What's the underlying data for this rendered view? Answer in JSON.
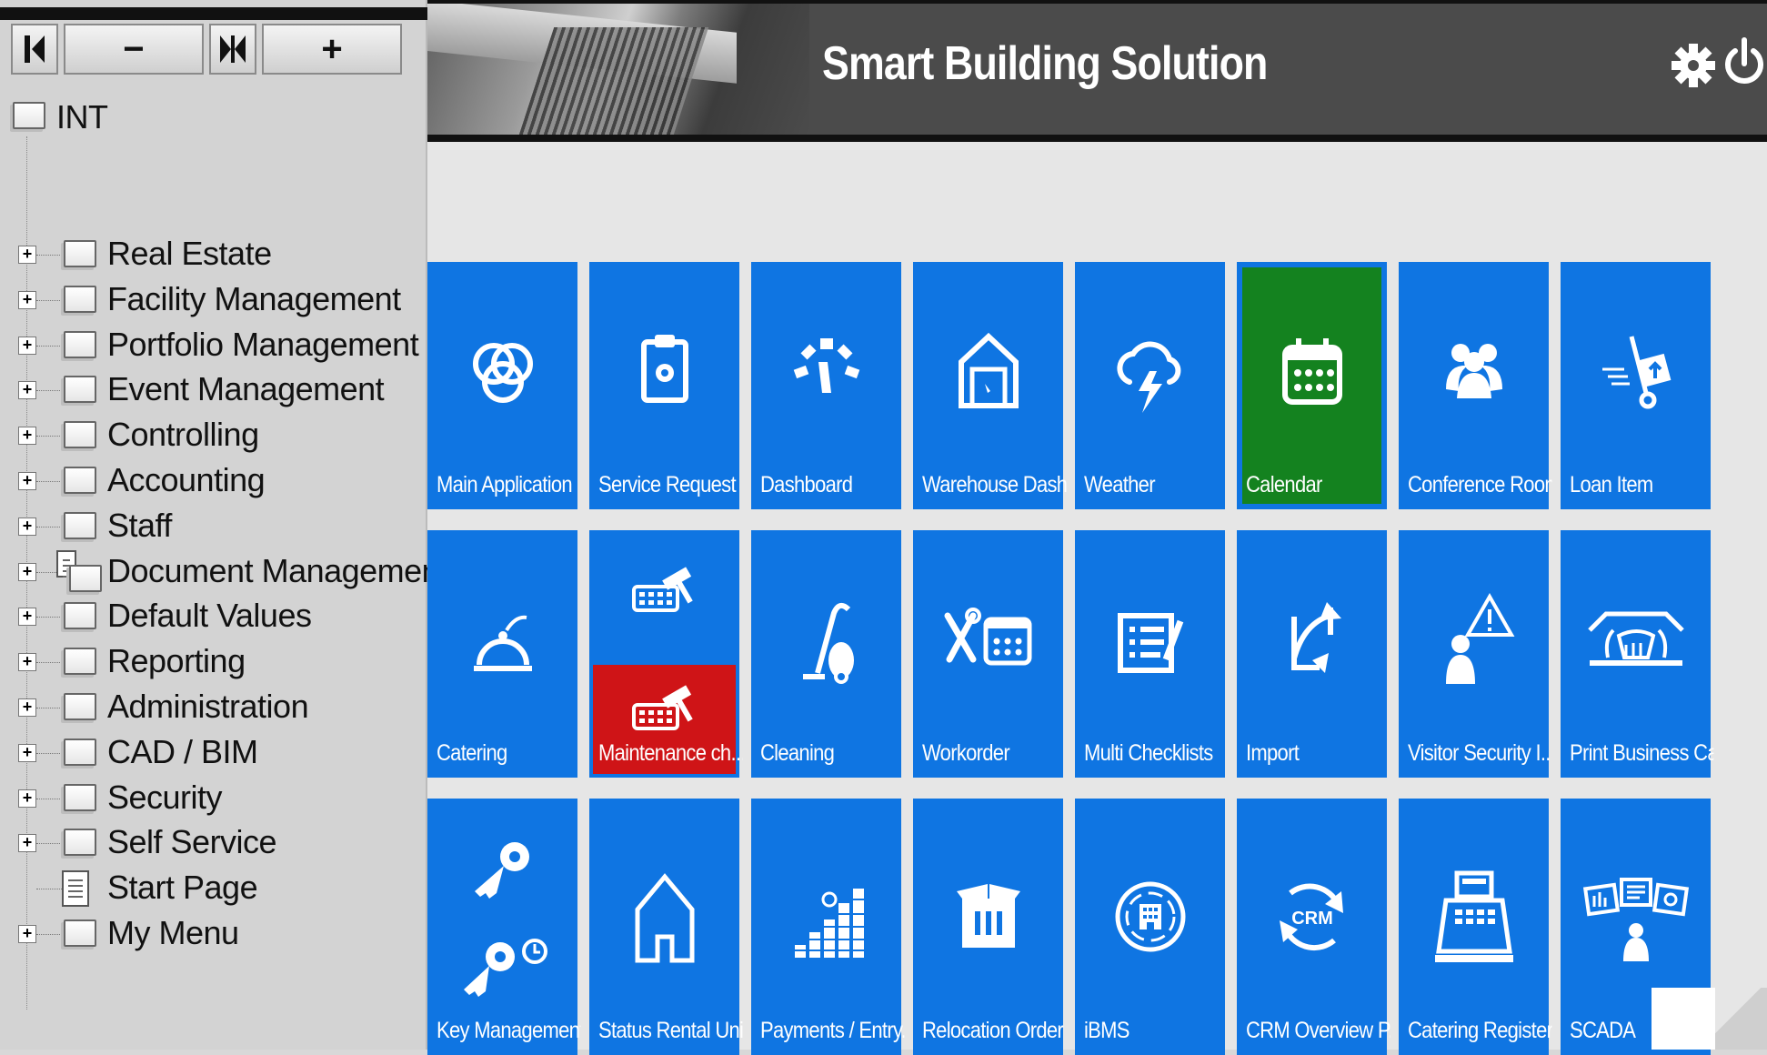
{
  "toolbar": {
    "first_symbol": "⏮",
    "collapse_label": "−",
    "split_symbol": "⧓",
    "expand_label": "+"
  },
  "tree": {
    "root_label": "INT",
    "items": [
      {
        "label": "Real Estate",
        "icon": "folder-icon",
        "expandable": true
      },
      {
        "label": "Facility Management",
        "icon": "folder-icon",
        "expandable": true
      },
      {
        "label": "Portfolio Management",
        "icon": "folder-icon",
        "expandable": true
      },
      {
        "label": "Event Management",
        "icon": "folder-icon",
        "expandable": true
      },
      {
        "label": "Controlling",
        "icon": "folder-icon",
        "expandable": true
      },
      {
        "label": "Accounting",
        "icon": "folder-icon",
        "expandable": true
      },
      {
        "label": "Staff",
        "icon": "folder-icon",
        "expandable": true
      },
      {
        "label": "Document Management",
        "icon": "document-folder-icon",
        "expandable": true
      },
      {
        "label": "Default Values",
        "icon": "folder-icon",
        "expandable": true
      },
      {
        "label": "Reporting",
        "icon": "folder-icon",
        "expandable": true
      },
      {
        "label": "Administration",
        "icon": "folder-icon",
        "expandable": true
      },
      {
        "label": "CAD / BIM",
        "icon": "folder-icon",
        "expandable": true
      },
      {
        "label": "Security",
        "icon": "folder-icon",
        "expandable": true
      },
      {
        "label": "Self Service",
        "icon": "folder-icon",
        "expandable": true
      },
      {
        "label": "Start Page",
        "icon": "page-icon",
        "expandable": false
      },
      {
        "label": "My Menu",
        "icon": "folder-icon",
        "expandable": true
      }
    ]
  },
  "header": {
    "title": "Smart Building Solution",
    "settings_icon": "gear-icon",
    "power_icon": "power-icon"
  },
  "tiles": [
    {
      "label": "Main Application",
      "icon": "rings-icon"
    },
    {
      "label": "Service Request",
      "icon": "clipboard-gear-icon"
    },
    {
      "label": "Dashboard",
      "icon": "gauge-icon"
    },
    {
      "label": "Warehouse Dash...",
      "icon": "warehouse-icon"
    },
    {
      "label": "Weather",
      "icon": "storm-cloud-icon"
    },
    {
      "label": "Calendar",
      "icon": "calendar-icon",
      "state": "selected"
    },
    {
      "label": "Conference Room",
      "icon": "people-group-icon"
    },
    {
      "label": "Loan Item",
      "icon": "hand-truck-icon"
    },
    {
      "label": "Catering",
      "icon": "cloche-icon"
    },
    {
      "label": "Maintenance ch...",
      "icon": "keyboard-hammer-icon",
      "state": "alert"
    },
    {
      "label": "Cleaning",
      "icon": "vacuum-icon"
    },
    {
      "label": "Workorder",
      "icon": "tools-calendar-icon"
    },
    {
      "label": "Multi Checklists",
      "icon": "checklist-icon"
    },
    {
      "label": "Import",
      "icon": "import-arrows-icon"
    },
    {
      "label": "Visitor Security I...",
      "icon": "visitor-warning-icon"
    },
    {
      "label": "Print Business Ca...",
      "icon": "card-printer-icon"
    },
    {
      "label": "Key Management",
      "icon": "key-icon"
    },
    {
      "label": "Status Rental Uni...",
      "icon": "house-outline-icon"
    },
    {
      "label": "Payments / Entry...",
      "icon": "coin-stacks-icon"
    },
    {
      "label": "Relocation Order",
      "icon": "moving-box-icon"
    },
    {
      "label": "iBMS",
      "icon": "building-circle-icon"
    },
    {
      "label": "CRM Overview P...",
      "icon": "crm-cycle-icon"
    },
    {
      "label": "Catering Register",
      "icon": "cash-register-icon"
    },
    {
      "label": "SCADA",
      "icon": "scada-monitors-icon"
    }
  ],
  "colors": {
    "tile_blue": "#0f75e2",
    "selected_green": "#14821f",
    "alert_red": "#cf1417",
    "header_bg": "#4b4b4b"
  }
}
